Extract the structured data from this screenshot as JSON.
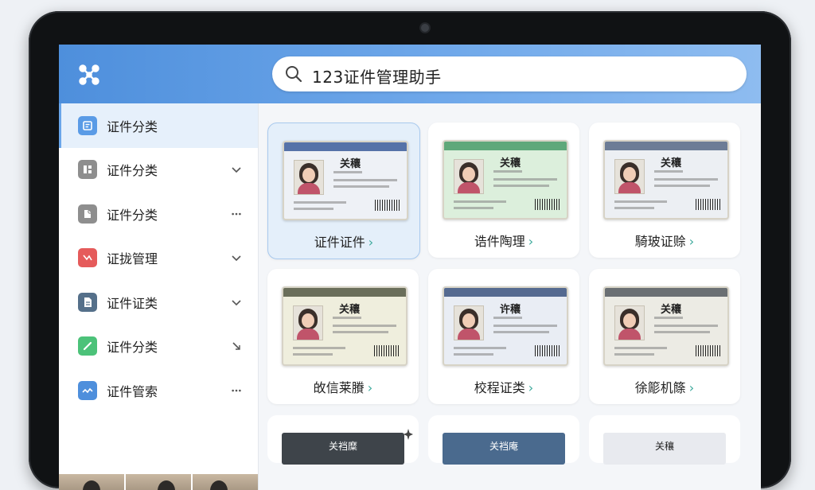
{
  "search": {
    "query": "123证件管理助手"
  },
  "sidebar": {
    "items": [
      {
        "label": "证件分类",
        "icon": "document-icon",
        "color": "#5a9be6",
        "trail": "none",
        "active": true
      },
      {
        "label": "证件分类",
        "icon": "grid-icon",
        "color": "#8e8e8e",
        "trail": "chevron-down-icon"
      },
      {
        "label": "证件分类",
        "icon": "file-refresh-icon",
        "color": "#8e8e8e",
        "trail": "more-icon"
      },
      {
        "label": "证拢管理",
        "icon": "shuffle-icon",
        "color": "#e55b5b",
        "trail": "chevron-down-icon"
      },
      {
        "label": "证件证类",
        "icon": "page-icon",
        "color": "#55708a",
        "trail": "chevron-down-icon"
      },
      {
        "label": "证件分类",
        "icon": "link-icon",
        "color": "#4cc279",
        "trail": "collapse-arrow-icon"
      },
      {
        "label": "证件管索",
        "icon": "wave-icon",
        "color": "#4e8fdc",
        "trail": "more-icon"
      }
    ]
  },
  "cards": [
    {
      "title": "证件证件",
      "card_text": "关穰",
      "band": "#5572a8",
      "bg": "#eef1f6",
      "active": true
    },
    {
      "title": "诰件陶理",
      "card_text": "关穰",
      "band": "#5fa87a",
      "bg": "#dcefdc"
    },
    {
      "title": "騎玻证赊",
      "card_text": "关穰",
      "band": "#6c7c96",
      "bg": "#eceff3"
    },
    {
      "title": "敀信莱賸",
      "card_text": "关穰",
      "band": "#6a6e5a",
      "bg": "#efeedd"
    },
    {
      "title": "校程证类",
      "card_text": "许穰",
      "band": "#556a90",
      "bg": "#e9edf4"
    },
    {
      "title": "徐簓机篨",
      "card_text": "关穰",
      "band": "#6a6f73",
      "bg": "#ecebe4"
    }
  ],
  "bottom_cards": [
    {
      "card_text": "关裆糜",
      "bg": "#3e444a"
    },
    {
      "card_text": "关裆庵",
      "bg": "#4a6a8e"
    },
    {
      "card_text": "关穰",
      "bg": "#e8eaef"
    }
  ]
}
